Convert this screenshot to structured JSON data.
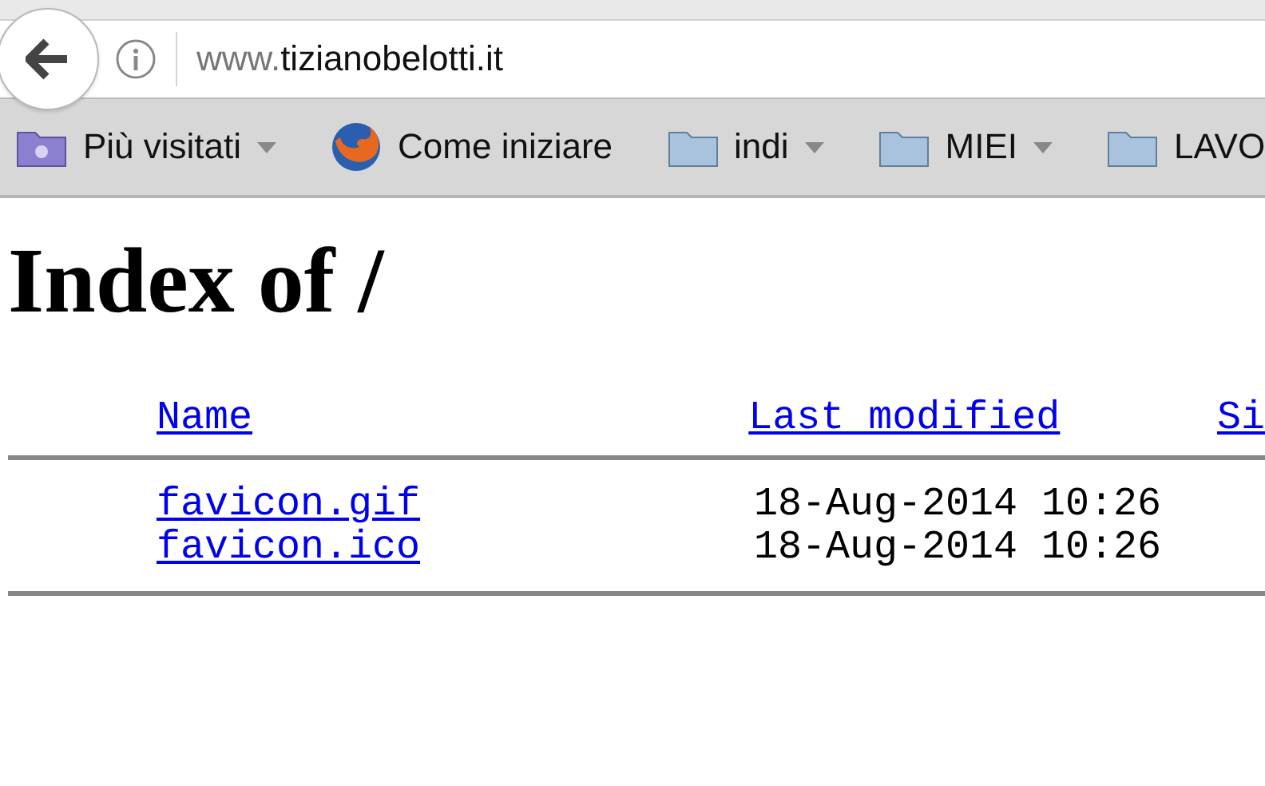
{
  "address_bar": {
    "url_prefix": "www.",
    "url_domain": "tizianobelotti.it"
  },
  "bookmarks": [
    {
      "kind": "smart-folder",
      "label": "Più visitati",
      "dropdown": true
    },
    {
      "kind": "browser",
      "label": "Come iniziare",
      "dropdown": false
    },
    {
      "kind": "folder",
      "label": "indi",
      "dropdown": true
    },
    {
      "kind": "folder",
      "label": "MIEI",
      "dropdown": true
    },
    {
      "kind": "folder",
      "label": "LAVO",
      "dropdown": false
    }
  ],
  "page": {
    "heading": "Index of /",
    "columns": [
      "Name",
      "Last modified",
      "Si"
    ],
    "rows": [
      {
        "name": "favicon.gif",
        "modified": "18-Aug-2014 10:26"
      },
      {
        "name": "favicon.ico",
        "modified": "18-Aug-2014 10:26"
      }
    ]
  }
}
